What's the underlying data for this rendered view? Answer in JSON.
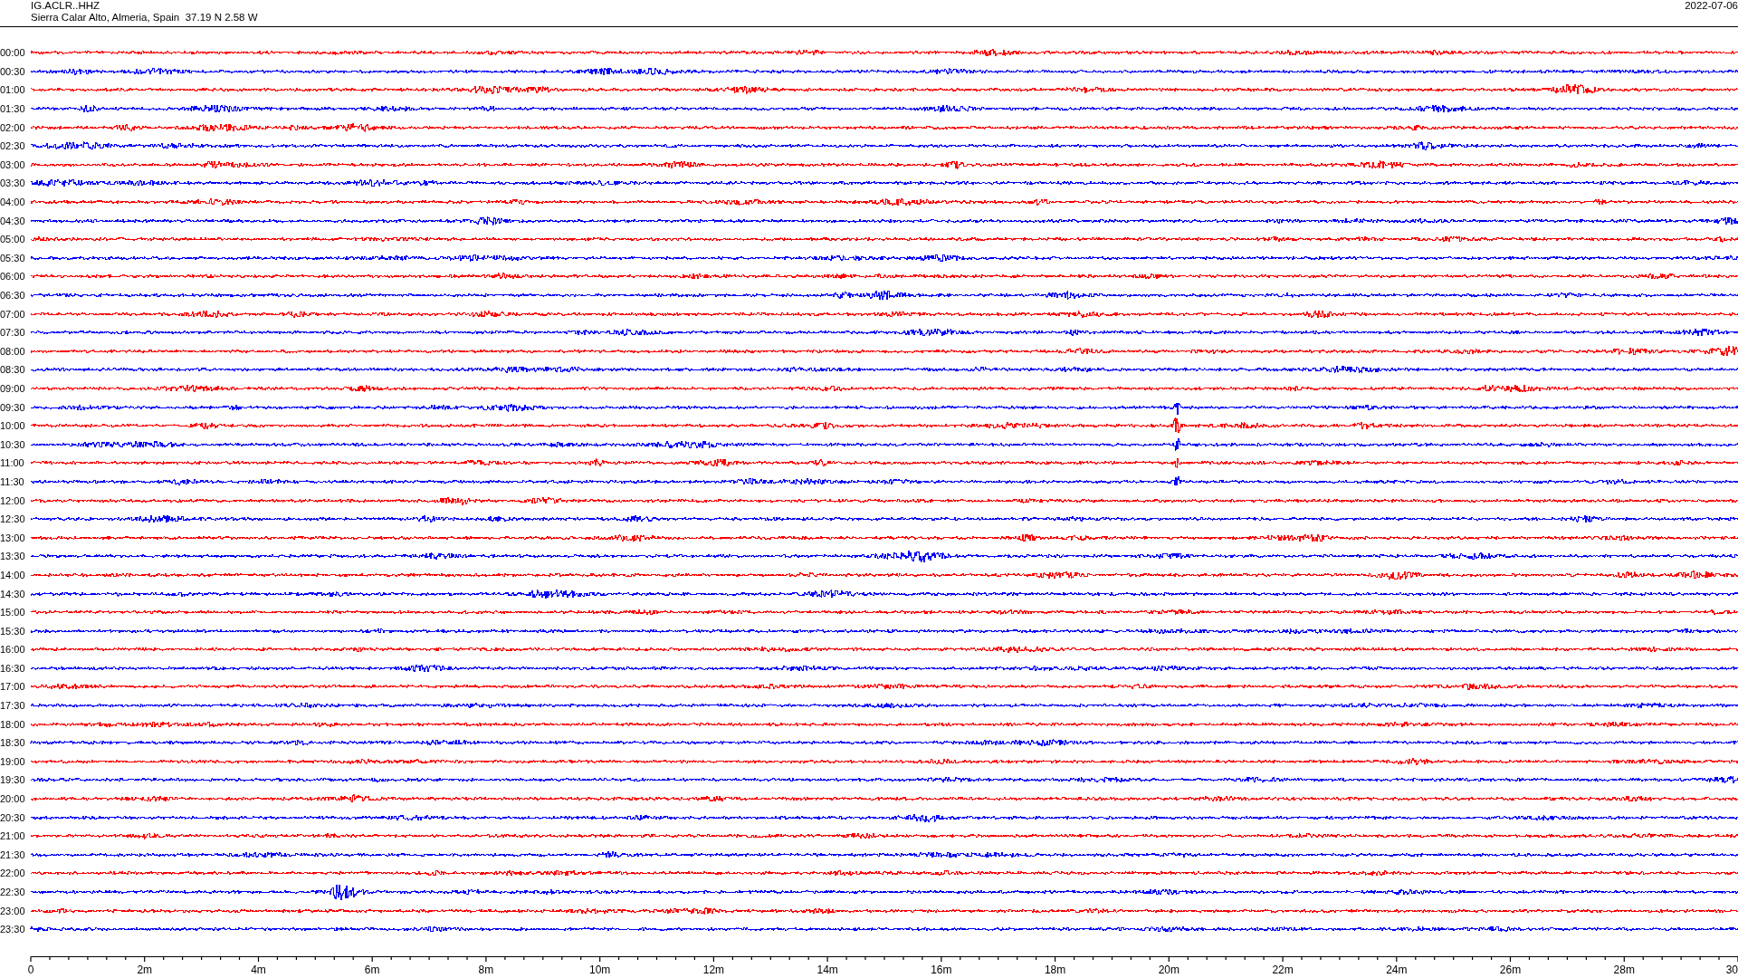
{
  "header": {
    "station": "IG.ACLR..HHZ",
    "location": "Sierra Calar Alto, Almeria, Spain  37.19 N 2.58 W",
    "date": "2022-07-06"
  },
  "rows": [
    {
      "time": "00:00",
      "color": "#ff0000"
    },
    {
      "time": "00:30",
      "color": "#0000ff"
    },
    {
      "time": "01:00",
      "color": "#ff0000"
    },
    {
      "time": "01:30",
      "color": "#0000ff"
    },
    {
      "time": "02:00",
      "color": "#ff0000"
    },
    {
      "time": "02:30",
      "color": "#0000ff"
    },
    {
      "time": "03:00",
      "color": "#ff0000"
    },
    {
      "time": "03:30",
      "color": "#0000ff"
    },
    {
      "time": "04:00",
      "color": "#ff0000"
    },
    {
      "time": "04:30",
      "color": "#0000ff"
    },
    {
      "time": "05:00",
      "color": "#ff0000"
    },
    {
      "time": "05:30",
      "color": "#0000ff"
    },
    {
      "time": "06:00",
      "color": "#ff0000"
    },
    {
      "time": "06:30",
      "color": "#0000ff"
    },
    {
      "time": "07:00",
      "color": "#ff0000"
    },
    {
      "time": "07:30",
      "color": "#0000ff"
    },
    {
      "time": "08:00",
      "color": "#ff0000"
    },
    {
      "time": "08:30",
      "color": "#0000ff"
    },
    {
      "time": "09:00",
      "color": "#ff0000"
    },
    {
      "time": "09:30",
      "color": "#0000ff"
    },
    {
      "time": "10:00",
      "color": "#ff0000"
    },
    {
      "time": "10:30",
      "color": "#0000ff"
    },
    {
      "time": "11:00",
      "color": "#ff0000"
    },
    {
      "time": "11:30",
      "color": "#0000ff"
    },
    {
      "time": "12:00",
      "color": "#ff0000"
    },
    {
      "time": "12:30",
      "color": "#0000ff"
    },
    {
      "time": "13:00",
      "color": "#ff0000"
    },
    {
      "time": "13:30",
      "color": "#0000ff"
    },
    {
      "time": "14:00",
      "color": "#ff0000"
    },
    {
      "time": "14:30",
      "color": "#0000ff"
    },
    {
      "time": "15:00",
      "color": "#ff0000"
    },
    {
      "time": "15:30",
      "color": "#0000ff"
    },
    {
      "time": "16:00",
      "color": "#ff0000"
    },
    {
      "time": "16:30",
      "color": "#0000ff"
    },
    {
      "time": "17:00",
      "color": "#ff0000"
    },
    {
      "time": "17:30",
      "color": "#0000ff"
    },
    {
      "time": "18:00",
      "color": "#ff0000"
    },
    {
      "time": "18:30",
      "color": "#0000ff"
    },
    {
      "time": "19:00",
      "color": "#ff0000"
    },
    {
      "time": "19:30",
      "color": "#0000ff"
    },
    {
      "time": "20:00",
      "color": "#ff0000"
    },
    {
      "time": "20:30",
      "color": "#0000ff"
    },
    {
      "time": "21:00",
      "color": "#ff0000"
    },
    {
      "time": "21:30",
      "color": "#0000ff"
    },
    {
      "time": "22:00",
      "color": "#ff0000"
    },
    {
      "time": "22:30",
      "color": "#0000ff"
    },
    {
      "time": "23:00",
      "color": "#ff0000"
    },
    {
      "time": "23:30",
      "color": "#0000ff"
    }
  ],
  "x_axis": {
    "ticks": [
      "0",
      "2m",
      "4m",
      "6m",
      "8m",
      "10m",
      "12m",
      "14m",
      "16m",
      "18m",
      "20m",
      "22m",
      "24m",
      "26m",
      "28m",
      "30"
    ]
  }
}
